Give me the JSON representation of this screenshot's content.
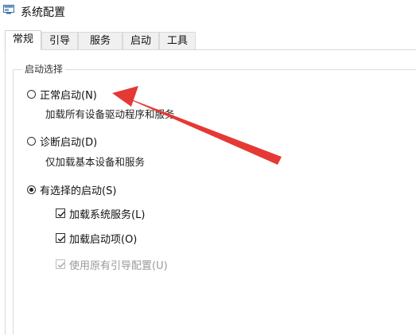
{
  "window": {
    "title": "系统配置",
    "icon": "msconfig-icon"
  },
  "tabs": [
    {
      "label": "常规",
      "active": true
    },
    {
      "label": "引导",
      "active": false
    },
    {
      "label": "服务",
      "active": false
    },
    {
      "label": "启动",
      "active": false
    },
    {
      "label": "工具",
      "active": false
    }
  ],
  "startup_selection": {
    "legend": "启动选择",
    "normal": {
      "label": "正常启动(N)",
      "description": "加载所有设备驱动程序和服务",
      "checked": false
    },
    "diagnostic": {
      "label": "诊断启动(D)",
      "description": "仅加载基本设备和服务",
      "checked": false
    },
    "selective": {
      "label": "有选择的启动(S)",
      "checked": true
    },
    "options": [
      {
        "label": "加载系统服务(L)",
        "checked": true,
        "enabled": true
      },
      {
        "label": "加载启动项(O)",
        "checked": true,
        "enabled": true
      },
      {
        "label": "使用原有引导配置(U)",
        "checked": true,
        "enabled": false
      }
    ]
  },
  "annotation": {
    "arrow_color": "#e53935"
  }
}
